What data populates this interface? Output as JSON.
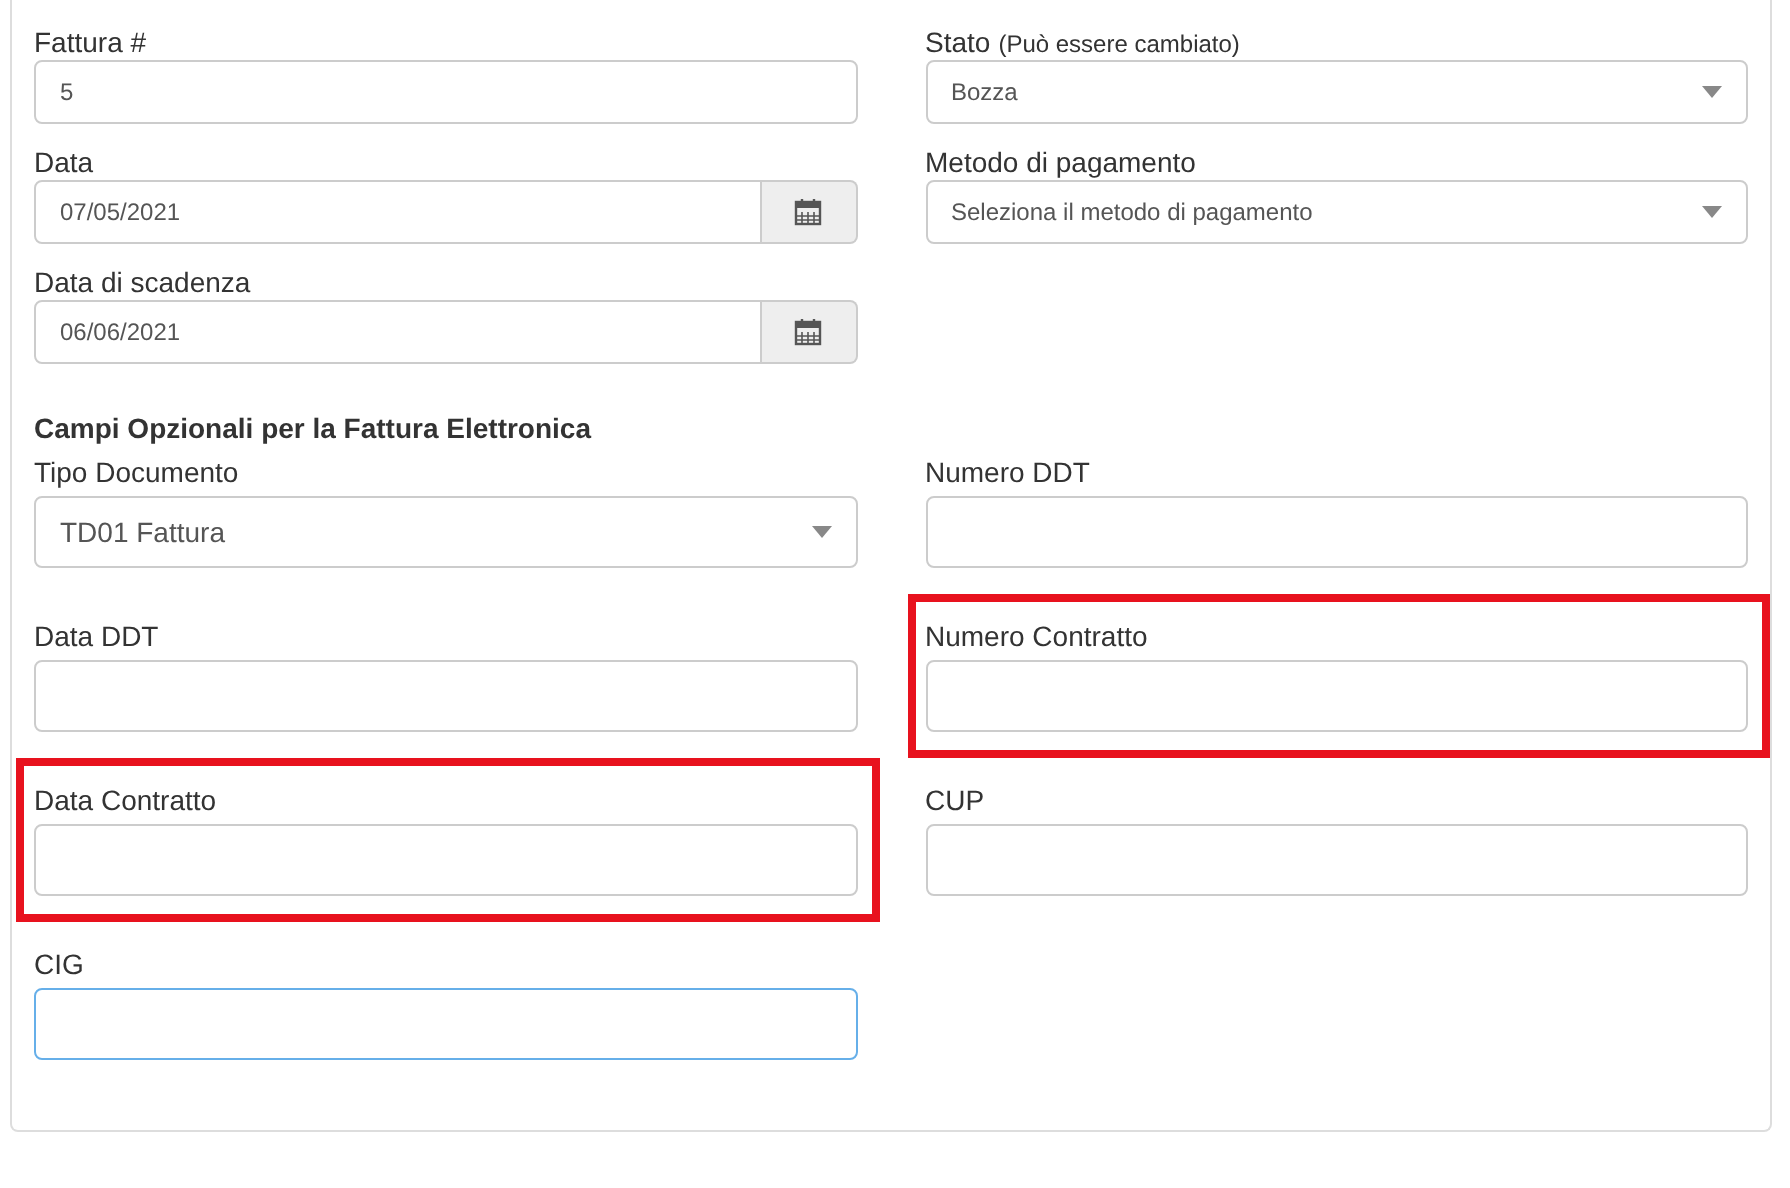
{
  "main_fields": {
    "left": [
      {
        "kind": "text",
        "label": "Fattura #",
        "value": "5"
      },
      {
        "kind": "date",
        "label": "Data",
        "value": "07/05/2021"
      },
      {
        "kind": "date",
        "label": "Data di scadenza",
        "value": "06/06/2021"
      }
    ],
    "right": [
      {
        "kind": "select",
        "label": "Stato",
        "hint": "(Può essere cambiato)",
        "value": "Bozza"
      },
      {
        "kind": "select",
        "label": "Metodo di pagamento",
        "value": "Seleziona il metodo di pagamento"
      }
    ]
  },
  "optional_section": {
    "title": "Campi Opzionali per la Fattura Elettronica",
    "fields": [
      {
        "kind": "select",
        "label": "Tipo Documento",
        "value": "TD01 Fattura",
        "highlighted": false,
        "focused": false
      },
      {
        "kind": "text",
        "label": "Numero DDT",
        "highlighted": false,
        "focused": false
      },
      {
        "kind": "text",
        "label": "Data DDT",
        "highlighted": false,
        "focused": false
      },
      {
        "kind": "text",
        "label": "Numero Contratto",
        "highlighted": true,
        "focused": false
      },
      {
        "kind": "text",
        "label": "Data Contratto",
        "highlighted": true,
        "focused": false
      },
      {
        "kind": "text",
        "label": "CUP",
        "highlighted": false,
        "focused": false
      },
      {
        "kind": "text",
        "label": "CIG",
        "highlighted": false,
        "focused": true
      }
    ]
  }
}
